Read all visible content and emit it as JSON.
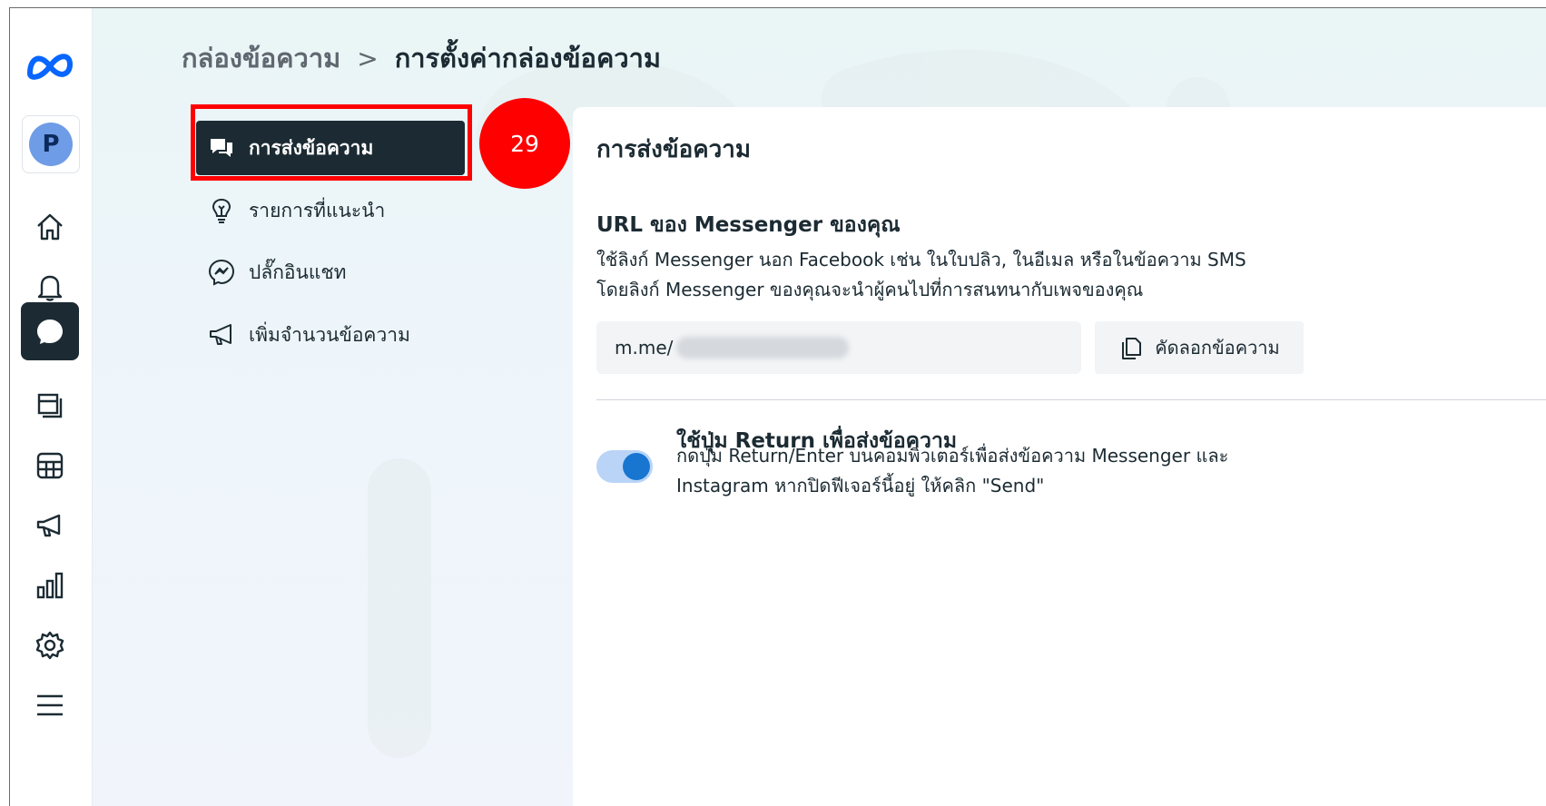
{
  "breadcrumb": {
    "parent": "กล่องข้อความ",
    "separator": ">",
    "current": "การตั้งค่ากล่องข้อความ"
  },
  "rail": {
    "avatar_initial": "P",
    "icons": [
      "meta-logo-icon",
      "home-icon",
      "bell-icon",
      "chat-icon",
      "posts-icon",
      "grid-icon",
      "megaphone-icon",
      "bar-chart-icon",
      "gear-icon",
      "menu-icon"
    ],
    "active": "chat-icon"
  },
  "nav": {
    "items": [
      {
        "label": "การส่งข้อความ",
        "icon": "speech-bubbles-icon",
        "active": true
      },
      {
        "label": "รายการที่แนะนำ",
        "icon": "lightbulb-icon",
        "active": false
      },
      {
        "label": "ปลั๊กอินแชท",
        "icon": "messenger-icon",
        "active": false
      },
      {
        "label": "เพิ่มจำนวนข้อความ",
        "icon": "megaphone-icon",
        "active": false
      }
    ]
  },
  "annotation": {
    "step": "29"
  },
  "panel": {
    "title": "การส่งข้อความ",
    "url_section": {
      "title": "URL ของ Messenger ของคุณ",
      "desc_line1": "ใช้ลิงก์ Messenger นอก Facebook เช่น ในใบปลิว, ในอีเมล หรือในข้อความ SMS",
      "desc_line2": "โดยลิงก์ Messenger ของคุณจะนำผู้คนไปที่การสนทนากับเพจของคุณ",
      "url_prefix": "m.me/",
      "copy_label": "คัดลอกข้อความ"
    },
    "return_section": {
      "title": "ใช้ปุ่ม Return เพื่อส่งข้อความ",
      "desc_line1": "กดปุ่ม Return/Enter บนคอมพิวเตอร์เพื่อส่งข้อความ Messenger และ",
      "desc_line2": "Instagram หากปิดฟีเจอร์นี้อยู่ ให้คลิก \"Send\"",
      "enabled": true
    }
  },
  "colors": {
    "accent": "#1876d1",
    "dark": "#1c2b33",
    "highlight": "#ff0000"
  }
}
